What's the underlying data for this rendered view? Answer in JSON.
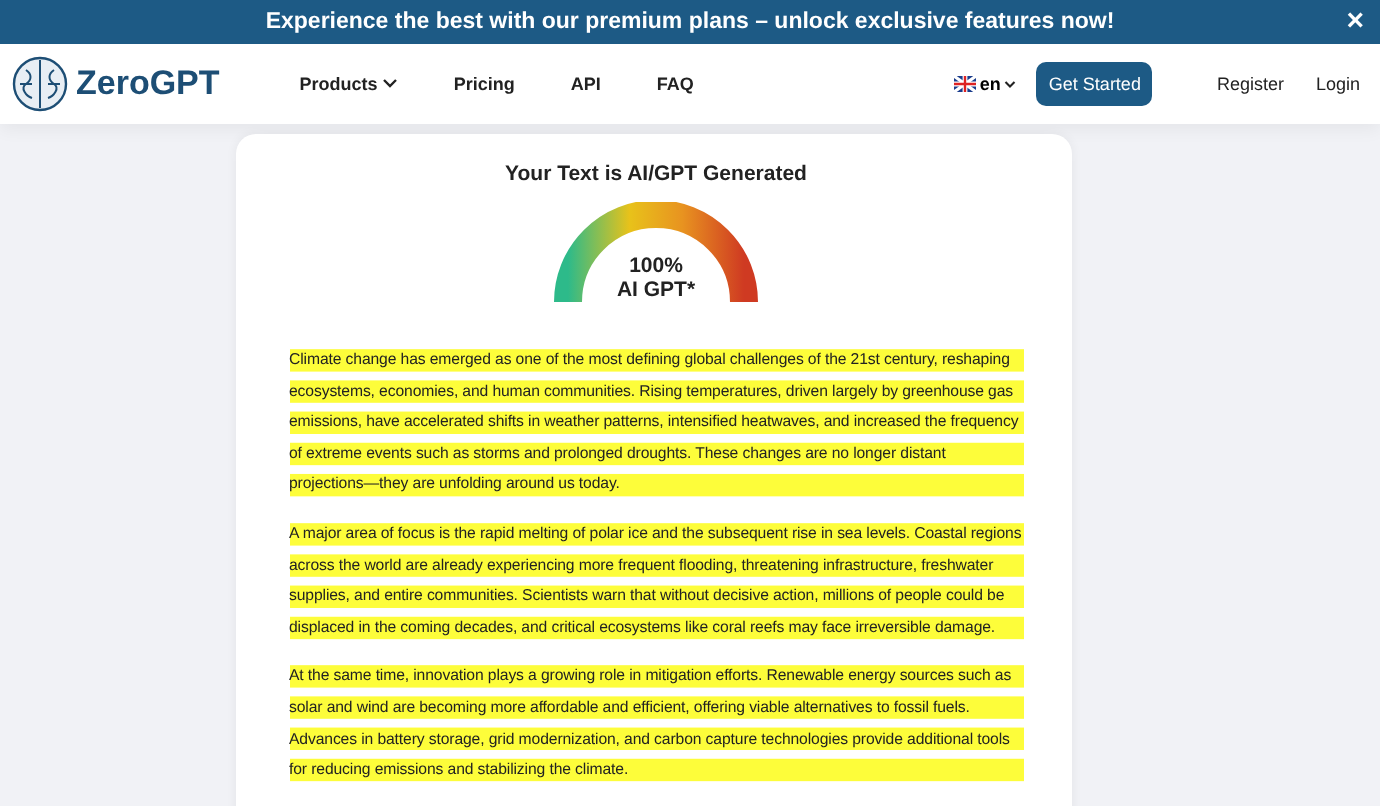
{
  "banner": {
    "text": "Experience the best with our premium plans – unlock exclusive features now!",
    "close": "×"
  },
  "nav": {
    "logo": "ZeroGPT",
    "links": [
      {
        "label": "Products",
        "dropdown": true
      },
      {
        "label": "Pricing",
        "dropdown": false
      },
      {
        "label": "API",
        "dropdown": false
      },
      {
        "label": "FAQ",
        "dropdown": false
      }
    ],
    "language": "en",
    "cta": "Get Started",
    "actions": [
      "Register",
      "Login"
    ]
  },
  "result": {
    "title": "Your Text is AI/GPT Generated",
    "percent": "100%",
    "verdict": "AI GPT*",
    "paragraphs": [
      "Climate change has emerged as one of the most defining global challenges of the 21st century, reshaping ecosystems, economies, and human communities. Rising temperatures, driven largely by greenhouse gas emissions, have accelerated shifts in weather patterns, intensified heatwaves, and increased the frequency of extreme events such as storms and prolonged droughts. These changes are no longer distant projections—they are unfolding around us today.",
      "A major area of focus is the rapid melting of polar ice and the subsequent rise in sea levels. Coastal regions across the world are already experiencing more frequent flooding, threatening infrastructure, freshwater supplies, and entire communities. Scientists warn that without decisive action, millions of people could be displaced in the coming decades, and critical ecosystems like coral reefs may face irreversible damage.",
      "At the same time, innovation plays a growing role in mitigation efforts. Renewable energy sources such as solar and wind are becoming more affordable and efficient, offering viable alternatives to fossil fuels. Advances in battery storage, grid modernization, and carbon capture technologies provide additional tools for reducing emissions and stabilizing the climate."
    ]
  }
}
